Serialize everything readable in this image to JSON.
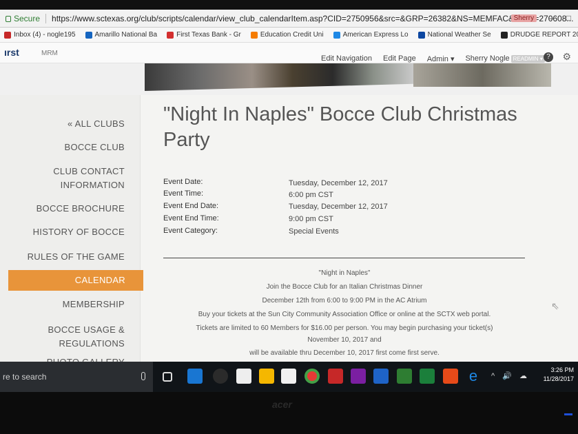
{
  "browser": {
    "secure_label": "Secure",
    "url": "https://www.sctexas.org/club/scripts/calendar/view_club_calendarItem.asp?CID=2750956&src=&GRP=26382&NS=MEMFAC&MFID=270608...",
    "profile": "Sherry",
    "minimize": "–",
    "restore": "□",
    "bookmarks": [
      {
        "label": "Inbox (4) - nogle195",
        "color": "#c62828"
      },
      {
        "label": "Amarillo National Ba",
        "color": "#1565c0"
      },
      {
        "label": "First Texas Bank - Gr",
        "color": "#d32f2f"
      },
      {
        "label": "Education Credit Uni",
        "color": "#f57c00"
      },
      {
        "label": "American Express Lo",
        "color": "#1e88e5"
      },
      {
        "label": "National Weather Se",
        "color": "#0d47a1"
      },
      {
        "label": "DRUDGE REPORT 20",
        "color": "#222222"
      }
    ]
  },
  "site": {
    "brand": "ırst",
    "mrm": "MRM",
    "admin_nav": {
      "edit_navigation": "Edit Navigation",
      "edit_page": "Edit Page",
      "admin": "Admin ▾",
      "user": "Sherry Nogle",
      "user_badge": "READMIN ▾"
    },
    "help": "?",
    "settings_glyph": "⚙"
  },
  "sidebar": {
    "items": [
      {
        "label": "« ALL CLUBS"
      },
      {
        "label": "BOCCE CLUB"
      },
      {
        "label": "CLUB CONTACT",
        "label2": "INFORMATION"
      },
      {
        "label": "BOCCE BROCHURE"
      },
      {
        "label": "HISTORY OF BOCCE"
      },
      {
        "label": "RULES OF THE GAME"
      },
      {
        "label": "CALENDAR",
        "active": true
      },
      {
        "label": "MEMBERSHIP"
      },
      {
        "label": "BOCCE USAGE &",
        "label2": "REGULATIONS"
      },
      {
        "label": "PHOTO GALLERY"
      }
    ]
  },
  "event": {
    "title_line1": "\"Night In Naples\" Bocce Club Christmas",
    "title_line2": "Party",
    "fields": [
      {
        "label": "Event Date:",
        "value": "Tuesday, December 12, 2017"
      },
      {
        "label": "Event Time:",
        "value": "6:00 pm CST"
      },
      {
        "label": "Event End Date:",
        "value": "Tuesday, December 12, 2017"
      },
      {
        "label": "Event End Time:",
        "value": "9:00 pm CST"
      },
      {
        "label": "Event Category:",
        "value": "Special Events"
      }
    ],
    "description": [
      "\"Night in Naples\"",
      "Join the Bocce Club for an Italian Christmas Dinner",
      "December 12th from 6:00 to 9:00 PM in the AC Atrium",
      "Buy your tickets at the Sun City Community Association Office or online at the SCTX web portal.",
      "Tickets are limited to 60 Members for $16.00 per person.  You may begin purchasing your ticket(s)",
      "November 10, 2017 and",
      "will be available thru December 10, 2017 first come first serve."
    ]
  },
  "taskbar": {
    "search_text": "re to search",
    "time": "3:26 PM",
    "date": "11/28/2017",
    "tray_icons": "^ 🔊 ☁"
  },
  "monitor": {
    "brand": "acer"
  }
}
